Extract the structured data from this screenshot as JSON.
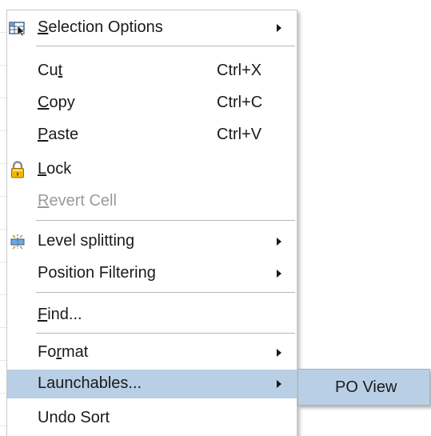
{
  "menu": {
    "selection_options": {
      "label_u": "S",
      "label_rest": "election Options"
    },
    "cut": {
      "label_pre": "Cu",
      "label_u": "t",
      "label_post": "",
      "shortcut": "Ctrl+X"
    },
    "copy": {
      "label_u": "C",
      "label_rest": "opy",
      "shortcut": "Ctrl+C"
    },
    "paste": {
      "label_u": "P",
      "label_rest": "aste",
      "shortcut": "Ctrl+V"
    },
    "lock": {
      "label_u": "L",
      "label_rest": "ock"
    },
    "revert_cell": {
      "label_u": "R",
      "label_rest": "evert Cell"
    },
    "level_splitting": {
      "label": "Level splitting"
    },
    "position_filtering": {
      "label": "Position Filtering"
    },
    "find": {
      "label_u": "F",
      "label_rest": "ind..."
    },
    "format": {
      "label_pre": "Fo",
      "label_u": "r",
      "label_post": "mat"
    },
    "launchables": {
      "label": "Launchables..."
    },
    "undo_sort": {
      "label": "Undo Sort"
    }
  },
  "submenu": {
    "po_view": "PO View"
  },
  "colors": {
    "highlight": "#b9cfe5",
    "disabled_text": "#9a9a9a",
    "lock_icon": "#d9a400"
  }
}
